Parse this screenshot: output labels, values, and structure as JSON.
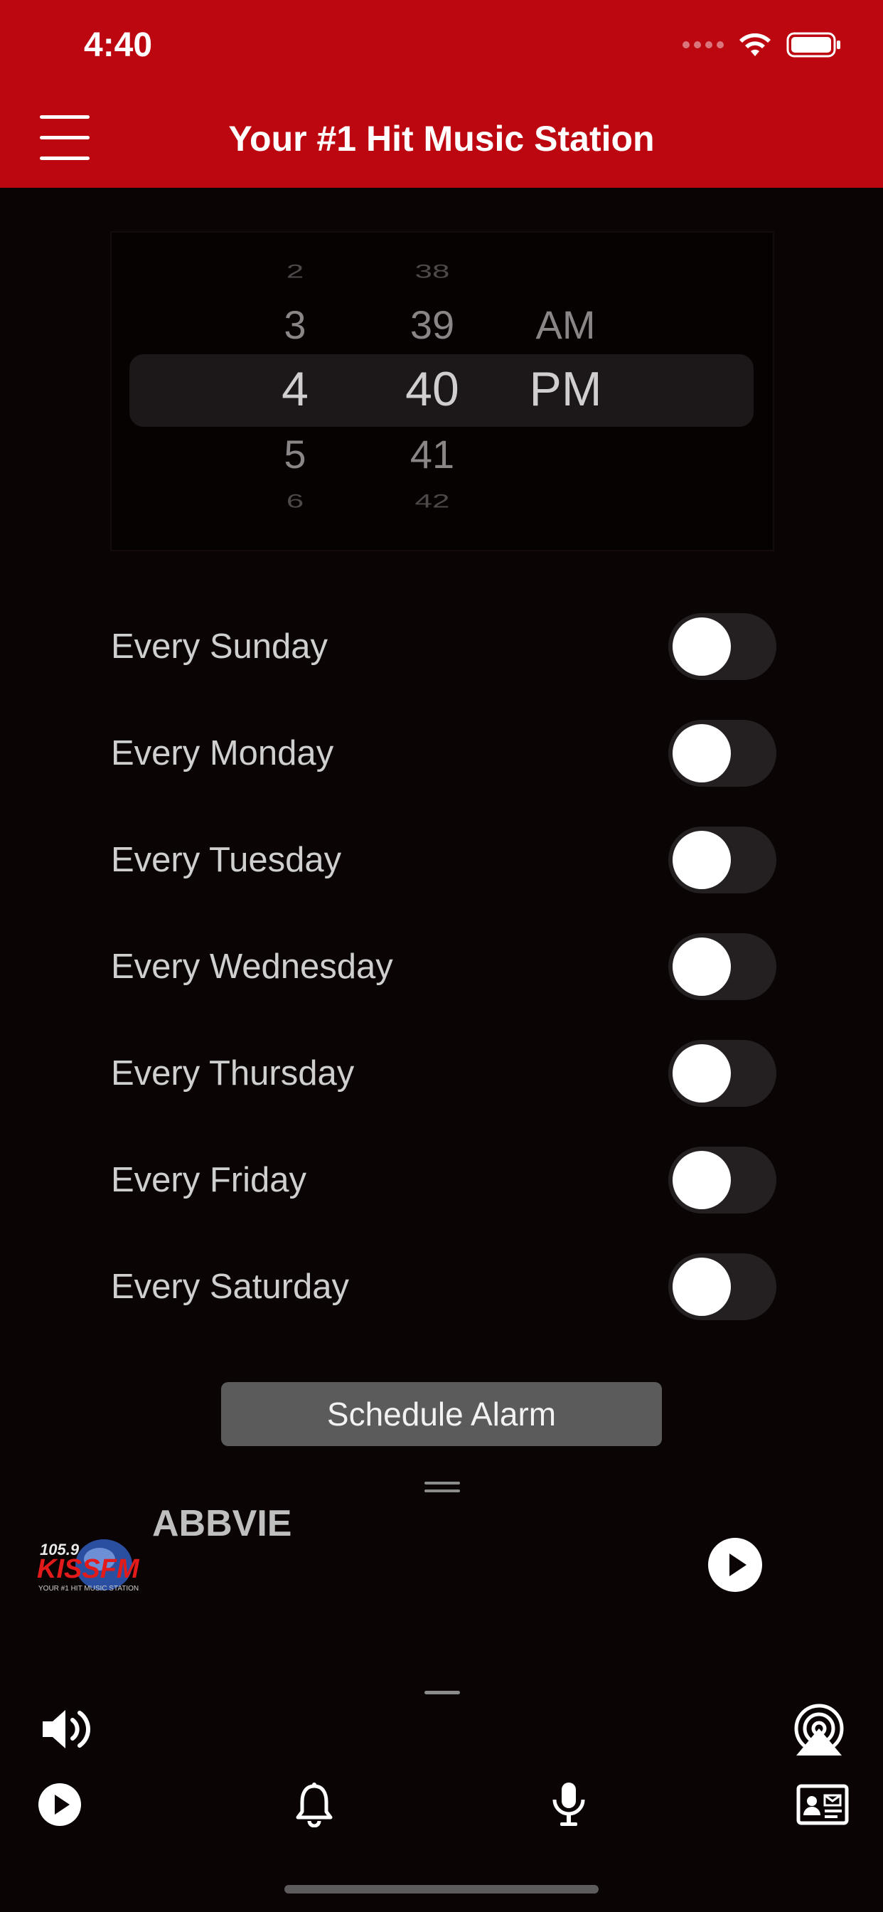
{
  "status_bar": {
    "time": "4:40"
  },
  "header": {
    "title": "Your #1 Hit Music Station"
  },
  "picker": {
    "hours": [
      "2",
      "3",
      "4",
      "5",
      "6"
    ],
    "minutes": [
      "38",
      "39",
      "40",
      "41",
      "42"
    ],
    "periods": [
      "AM",
      "PM"
    ]
  },
  "days": [
    {
      "label": "Every Sunday",
      "on": false
    },
    {
      "label": "Every Monday",
      "on": false
    },
    {
      "label": "Every Tuesday",
      "on": false
    },
    {
      "label": "Every Wednesday",
      "on": false
    },
    {
      "label": "Every Thursday",
      "on": false
    },
    {
      "label": "Every Friday",
      "on": false
    },
    {
      "label": "Every Saturday",
      "on": false
    }
  ],
  "schedule_button": "Schedule Alarm",
  "now_playing": {
    "station": "ABBVIE",
    "logo_text": "105.9 KISSFM"
  },
  "colors": {
    "brand_red": "#bc0710",
    "background": "#0a0405"
  }
}
